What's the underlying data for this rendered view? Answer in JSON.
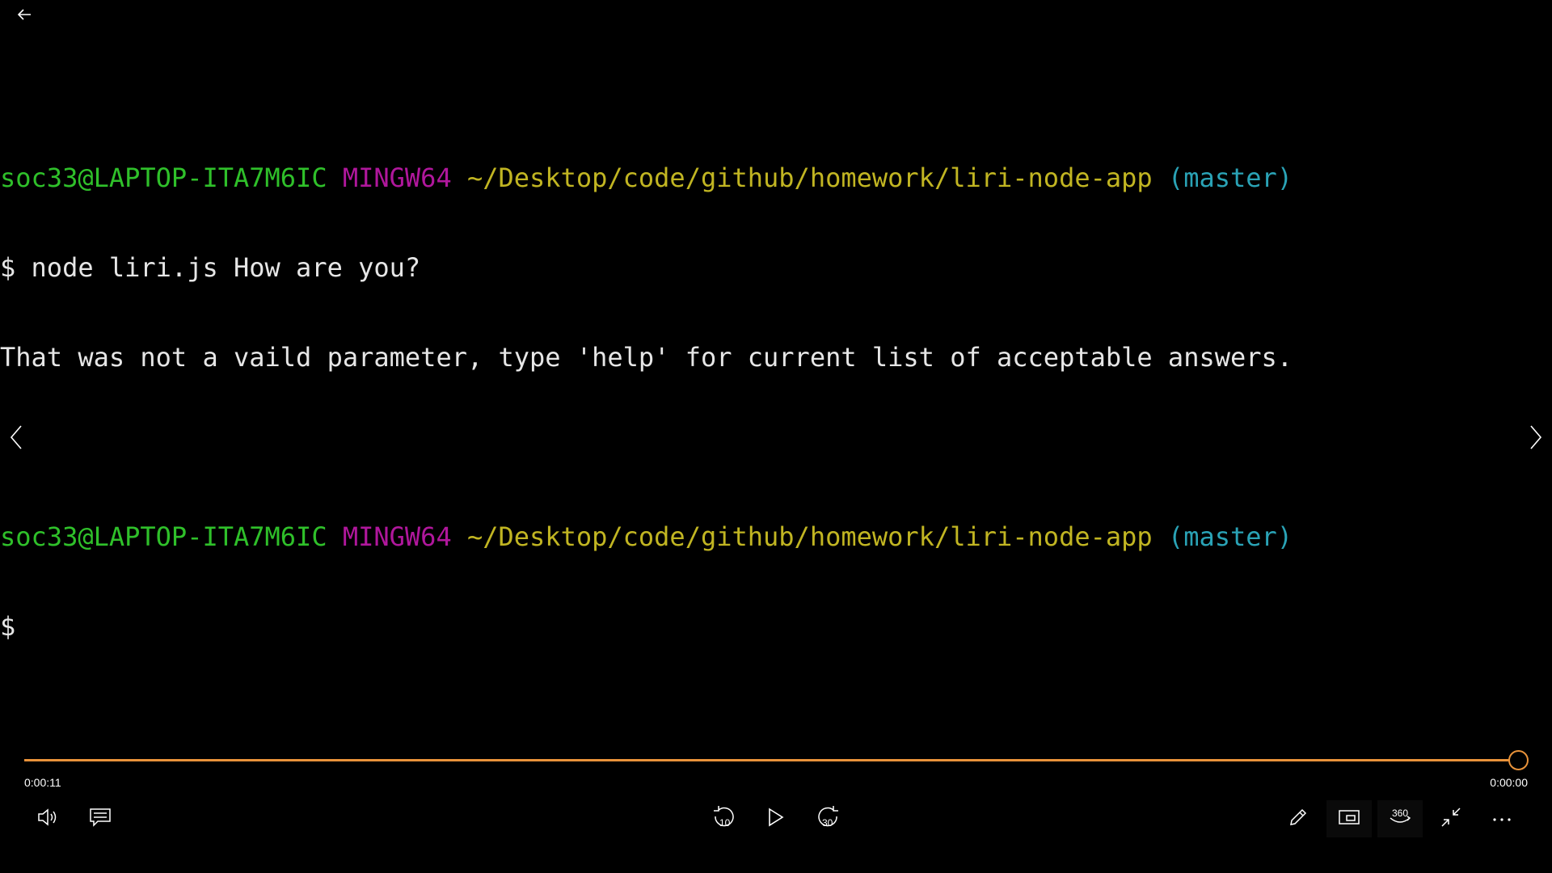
{
  "terminal": {
    "prompt1": {
      "user": "soc33@LAPTOP-ITA7M6IC",
      "system": "MINGW64",
      "path": "~/Desktop/code/github/homework/liri-node-app",
      "branch": "(master)"
    },
    "command_line": "$ node liri.js How are you?",
    "output_line": "That was not a vaild parameter, type 'help' for current list of acceptable answers.",
    "prompt2": {
      "user": "soc33@LAPTOP-ITA7M6IC",
      "system": "MINGW64",
      "path": "~/Desktop/code/github/homework/liri-node-app",
      "branch": "(master)"
    },
    "cursor_line": "$"
  },
  "player": {
    "time_elapsed": "0:00:11",
    "time_remaining": "0:00:00",
    "progress_fraction": 1.0,
    "accent_color": "#e8923a",
    "skip_back_label": "10",
    "skip_forward_label": "30",
    "view_360_label": "360"
  },
  "colors": {
    "user": "#2fc02a",
    "system": "#b0179c",
    "path": "#c1b522",
    "branch": "#2aa3b6"
  }
}
